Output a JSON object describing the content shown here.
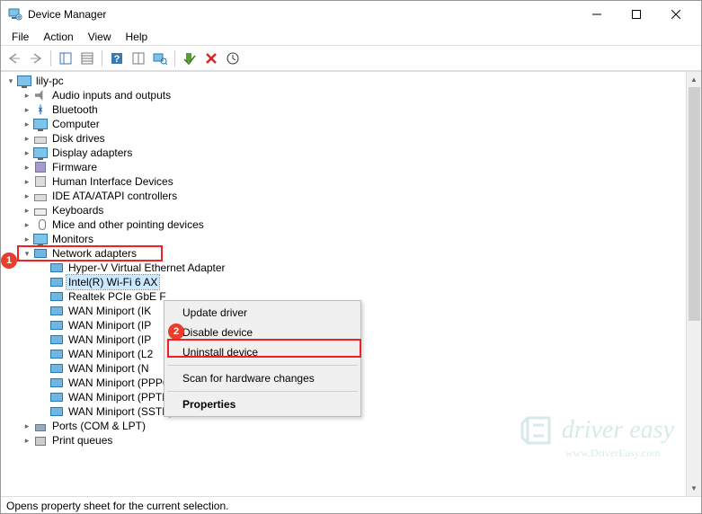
{
  "window": {
    "title": "Device Manager"
  },
  "menubar": [
    "File",
    "Action",
    "View",
    "Help"
  ],
  "tree": {
    "root": {
      "label": "lily-pc"
    },
    "categories": [
      {
        "label": "Audio inputs and outputs",
        "icon": "sound-icon"
      },
      {
        "label": "Bluetooth",
        "icon": "bluetooth-icon"
      },
      {
        "label": "Computer",
        "icon": "computer-icon"
      },
      {
        "label": "Disk drives",
        "icon": "drive-icon"
      },
      {
        "label": "Display adapters",
        "icon": "display-icon"
      },
      {
        "label": "Firmware",
        "icon": "chip-icon"
      },
      {
        "label": "Human Interface Devices",
        "icon": "hid-icon"
      },
      {
        "label": "IDE ATA/ATAPI controllers",
        "icon": "ide-icon"
      },
      {
        "label": "Keyboards",
        "icon": "keyboard-icon"
      },
      {
        "label": "Mice and other pointing devices",
        "icon": "mouse-icon"
      },
      {
        "label": "Monitors",
        "icon": "monitor-icon"
      },
      {
        "label": "Network adapters",
        "icon": "network-icon",
        "expanded": true,
        "highlighted": true,
        "children": [
          {
            "label": "Hyper-V Virtual Ethernet Adapter"
          },
          {
            "label": "Intel(R) Wi-Fi 6 AX",
            "selected": true,
            "truncated": true
          },
          {
            "label": "Realtek PCIe GbE F",
            "truncated": true
          },
          {
            "label": "WAN Miniport (IK",
            "truncated": true
          },
          {
            "label": "WAN Miniport (IP",
            "truncated": true
          },
          {
            "label": "WAN Miniport (IP",
            "truncated": true
          },
          {
            "label": "WAN Miniport (L2",
            "truncated": true
          },
          {
            "label": "WAN Miniport (N",
            "truncated": true
          },
          {
            "label": "WAN Miniport (PPPOE)"
          },
          {
            "label": "WAN Miniport (PPTP)"
          },
          {
            "label": "WAN Miniport (SSTP)"
          }
        ]
      },
      {
        "label": "Ports (COM & LPT)",
        "icon": "port-icon"
      },
      {
        "label": "Print queues",
        "icon": "printer-icon",
        "cutoff": true
      }
    ]
  },
  "context_menu": {
    "items": [
      {
        "label": "Update driver"
      },
      {
        "label": "Disable device"
      },
      {
        "label": "Uninstall device",
        "highlighted": true
      },
      {
        "sep": true
      },
      {
        "label": "Scan for hardware changes"
      },
      {
        "sep": true
      },
      {
        "label": "Properties",
        "bold": true
      }
    ]
  },
  "callouts": {
    "c1": "1",
    "c2": "2"
  },
  "statusbar": {
    "text": "Opens property sheet for the current selection."
  },
  "watermark": {
    "line1": "driver easy",
    "line2": "www.DriverEasy.com"
  }
}
